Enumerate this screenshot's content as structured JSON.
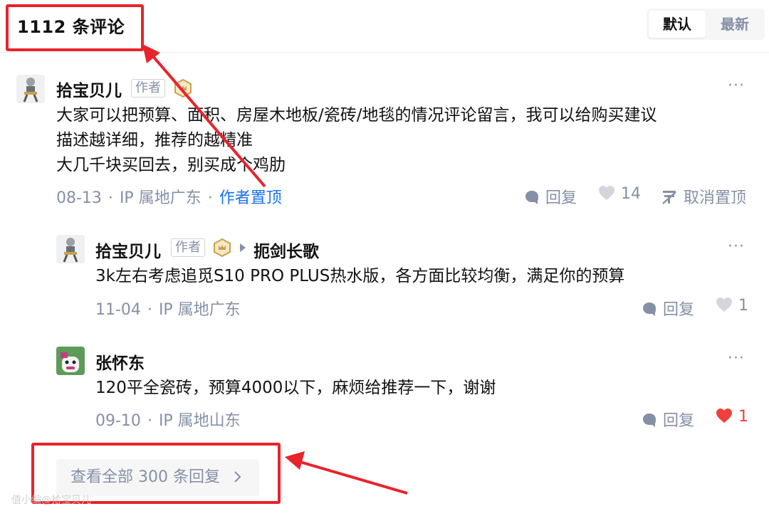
{
  "header": {
    "count_label": "1112 条评论",
    "sort_default": "默认",
    "sort_newest": "最新"
  },
  "comments": [
    {
      "author": "拾宝贝儿",
      "author_tag": "作者",
      "lines": [
        "大家可以把预算、面积、房屋木地板/瓷砖/地毯的情况评论留言，我可以给购买建议",
        "描述越详细，推荐的越精准",
        "大几千块买回去，别买成个鸡肋"
      ],
      "date": "08-13",
      "ip": "IP 属地广东",
      "pinned_label": "作者置顶",
      "reply_label": "回复",
      "likes": "14",
      "unpin_label": "取消置顶"
    },
    {
      "author": "拾宝贝儿",
      "author_tag": "作者",
      "reply_to": "扼剑长歌",
      "text": "3k左右考虑追觅S10 PRO PLUS热水版，各方面比较均衡，满足你的预算",
      "date": "11-04",
      "ip": "IP 属地广东",
      "reply_label": "回复",
      "likes": "1"
    },
    {
      "author": "张怀东",
      "text": "120平全瓷砖，预算4000以下，麻烦给推荐一下，谢谢",
      "date": "09-10",
      "ip": "IP 属地山东",
      "reply_label": "回复",
      "likes": "1",
      "liked": true
    }
  ],
  "view_all_label": "查看全部 300 条回复",
  "more_label": "···",
  "separator": "·",
  "watermark": "值小编@拾宝贝儿",
  "colors": {
    "accent_blue": "#1772f6",
    "muted": "#8590a6",
    "like_red": "#f1403c",
    "annotation_red": "#e8232b"
  }
}
